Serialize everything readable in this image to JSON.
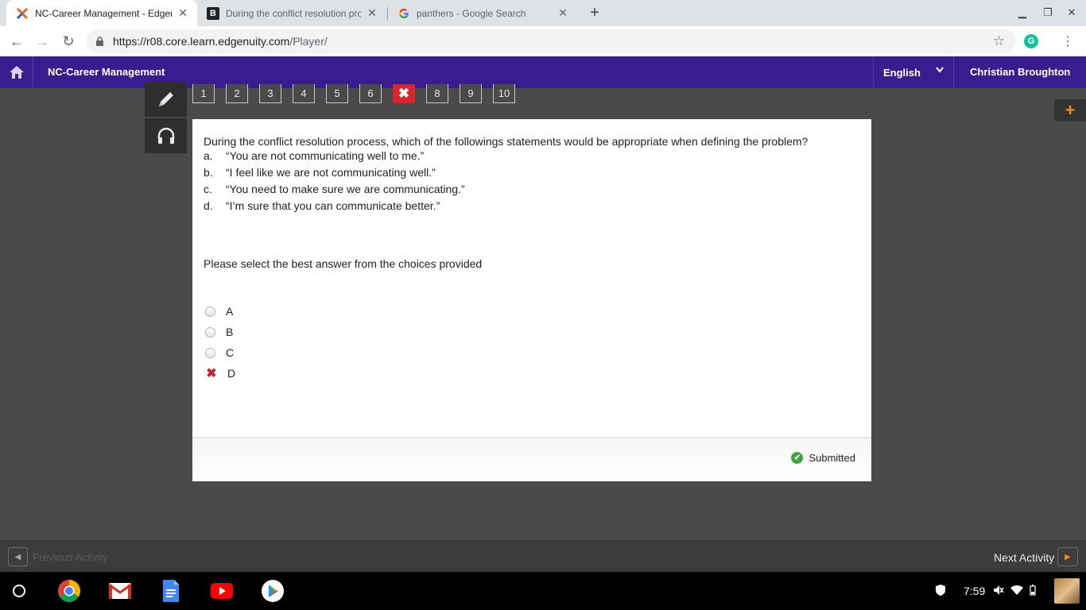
{
  "browser": {
    "tabs": [
      {
        "title": "NC-Career Management - Edgenuity",
        "active": true
      },
      {
        "title": "During the conflict resolution process",
        "active": false
      },
      {
        "title": "panthers - Google Search",
        "active": false
      }
    ],
    "url_host": "https://r08.core.learn.edgenuity.com",
    "url_path": "/Player/"
  },
  "app": {
    "course_title": "NC-Career Management",
    "language": "English",
    "user_name": "Christian Broughton"
  },
  "question_nav": {
    "items": [
      "1",
      "2",
      "3",
      "4",
      "5",
      "6",
      "✖",
      "8",
      "9",
      "10"
    ]
  },
  "question": {
    "text": "During the conflict resolution process, which of the followings statements would be appropriate when defining the problem?",
    "options": [
      {
        "letter": "a.",
        "text": "“You are not communicating well to me.”"
      },
      {
        "letter": "b.",
        "text": "“I feel like we are not communicating well.”"
      },
      {
        "letter": "c.",
        "text": "“You need to make sure we are communicating.”"
      },
      {
        "letter": "d.",
        "text": "“I’m sure that you can communicate better.”"
      }
    ],
    "prompt": "Please select the best answer from the choices provided",
    "choices": [
      "A",
      "B",
      "C",
      "D"
    ],
    "status": "Submitted"
  },
  "activity_nav": {
    "previous": "Previous Activity",
    "next": "Next Activity"
  },
  "system": {
    "time": "7:59"
  },
  "colors": {
    "brand_purple": "#3a1c8e",
    "wrong_red": "#d6262e",
    "accent_orange": "#f28c1a",
    "success_green": "#3fa33f"
  }
}
